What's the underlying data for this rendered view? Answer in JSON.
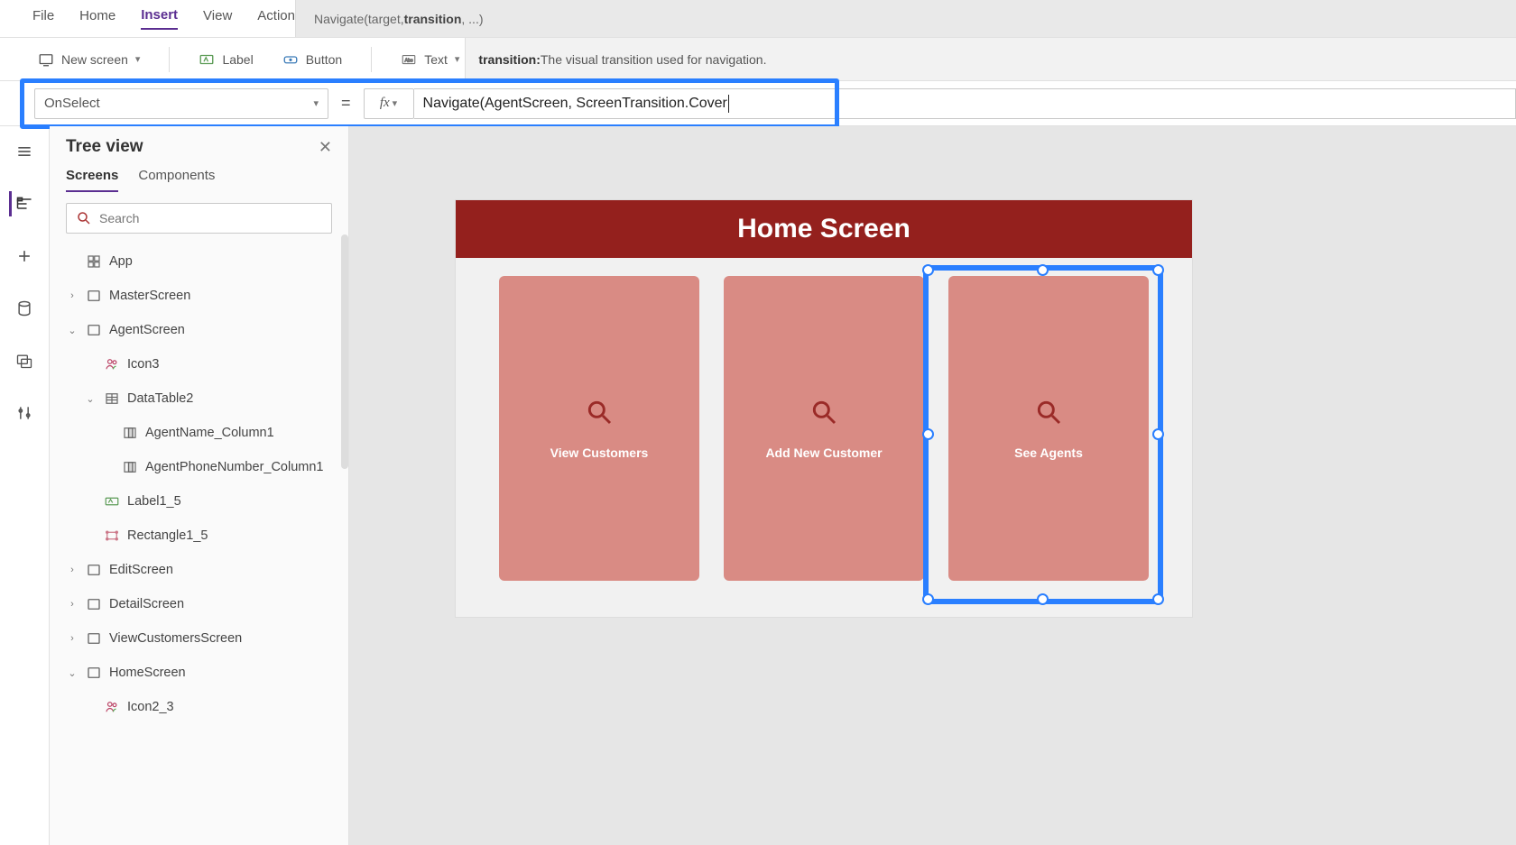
{
  "menu": {
    "items": [
      "File",
      "Home",
      "Insert",
      "View",
      "Action"
    ],
    "active": "Insert",
    "signature": {
      "prefix": "Navigate(target, ",
      "bold": "transition",
      "suffix": ", ...)"
    }
  },
  "ribbon": {
    "new_screen": "New screen",
    "label": "Label",
    "button": "Button",
    "text": "Text",
    "tooltip_key": "transition:",
    "tooltip_desc": " The visual transition used for navigation."
  },
  "formula": {
    "property": "OnSelect",
    "fx": "fx",
    "value": "Navigate(AgentScreen, ScreenTransition.Cover"
  },
  "tree": {
    "title": "Tree view",
    "tabs": [
      "Screens",
      "Components"
    ],
    "active_tab": "Screens",
    "search_placeholder": "Search",
    "rows": [
      {
        "indent": 0,
        "twisty": "",
        "icon": "app",
        "label": "App"
      },
      {
        "indent": 1,
        "twisty": "›",
        "icon": "screen",
        "label": "MasterScreen"
      },
      {
        "indent": 1,
        "twisty": "⌄",
        "icon": "screen",
        "label": "AgentScreen"
      },
      {
        "indent": 2,
        "twisty": "",
        "icon": "people",
        "label": "Icon3"
      },
      {
        "indent": 2,
        "twisty": "⌄",
        "icon": "table",
        "label": "DataTable2"
      },
      {
        "indent": 3,
        "twisty": "",
        "icon": "column",
        "label": "AgentName_Column1"
      },
      {
        "indent": 3,
        "twisty": "",
        "icon": "column",
        "label": "AgentPhoneNumber_Column1"
      },
      {
        "indent": 2,
        "twisty": "",
        "icon": "label",
        "label": "Label1_5"
      },
      {
        "indent": 2,
        "twisty": "",
        "icon": "rect",
        "label": "Rectangle1_5"
      },
      {
        "indent": 1,
        "twisty": "›",
        "icon": "screen",
        "label": "EditScreen"
      },
      {
        "indent": 1,
        "twisty": "›",
        "icon": "screen",
        "label": "DetailScreen"
      },
      {
        "indent": 1,
        "twisty": "›",
        "icon": "screen",
        "label": "ViewCustomersScreen"
      },
      {
        "indent": 1,
        "twisty": "⌄",
        "icon": "screen",
        "label": "HomeScreen"
      },
      {
        "indent": 2,
        "twisty": "",
        "icon": "people",
        "label": "Icon2_3"
      }
    ]
  },
  "canvas": {
    "header_title": "Home Screen",
    "tiles": [
      {
        "label": "View Customers"
      },
      {
        "label": "Add New Customer"
      },
      {
        "label": "See Agents",
        "selected": true
      }
    ]
  },
  "colors": {
    "accent": "#5b2e91",
    "highlight": "#2a7fff",
    "app_header": "#94201d",
    "tile": "#d98b84"
  }
}
